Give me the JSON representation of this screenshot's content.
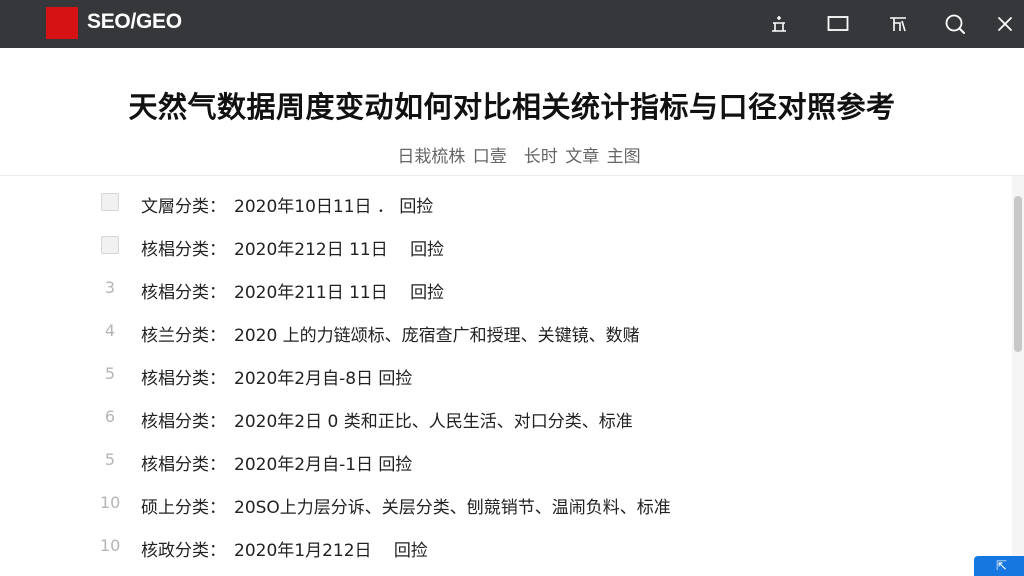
{
  "topbar": {
    "brand": "SEO/GEO",
    "icons": [
      "bookmark-icon",
      "window-icon",
      "font-icon",
      "search-icon",
      "close-icon"
    ]
  },
  "article": {
    "title": "天然气数据周度变动如何对比相关统计指标与口径对照参考",
    "subtitle": "日栽梳株 口壹　长时 文章 主图"
  },
  "rows": [
    {
      "marker": "",
      "marker_type": "checkbox",
      "category": "文層分类：",
      "content": "2020年10日11日 ． 回捡"
    },
    {
      "marker": "",
      "marker_type": "checkbox",
      "category": "核椙分类：",
      "content": "2020年212日 11日　 回捡"
    },
    {
      "marker": "3",
      "marker_type": "number",
      "category": "核椙分类：",
      "content": "2020年211日 11日　 回捡"
    },
    {
      "marker": "4",
      "marker_type": "number",
      "category": "核兰分类：",
      "content": "2020 上的力链颂标、庞宿查广和授理、关键镜、数赌"
    },
    {
      "marker": "5",
      "marker_type": "number",
      "category": "核椙分类：",
      "content": "2020年2月自-8日 回捡"
    },
    {
      "marker": "6",
      "marker_type": "number",
      "category": "核椙分类：",
      "content": "2020年2日 0 类和正比、人民生活、对口分类、标准"
    },
    {
      "marker": "5",
      "marker_type": "number",
      "category": "核椙分类：",
      "content": "2020年2月自-1日 回捡"
    },
    {
      "marker": "10",
      "marker_type": "number",
      "category": "硕上分类：",
      "content": "20SO上力层分诉、关层分类、刨競销节、温闹负料、标准"
    },
    {
      "marker": "10",
      "marker_type": "number",
      "category": "核政分类：",
      "content": "2020年1月212日　 回捡"
    }
  ],
  "floating_button": {
    "label": "⇱"
  },
  "colors": {
    "topbar": "#35373a",
    "logo": "#d71214",
    "accent": "#1677e0"
  }
}
